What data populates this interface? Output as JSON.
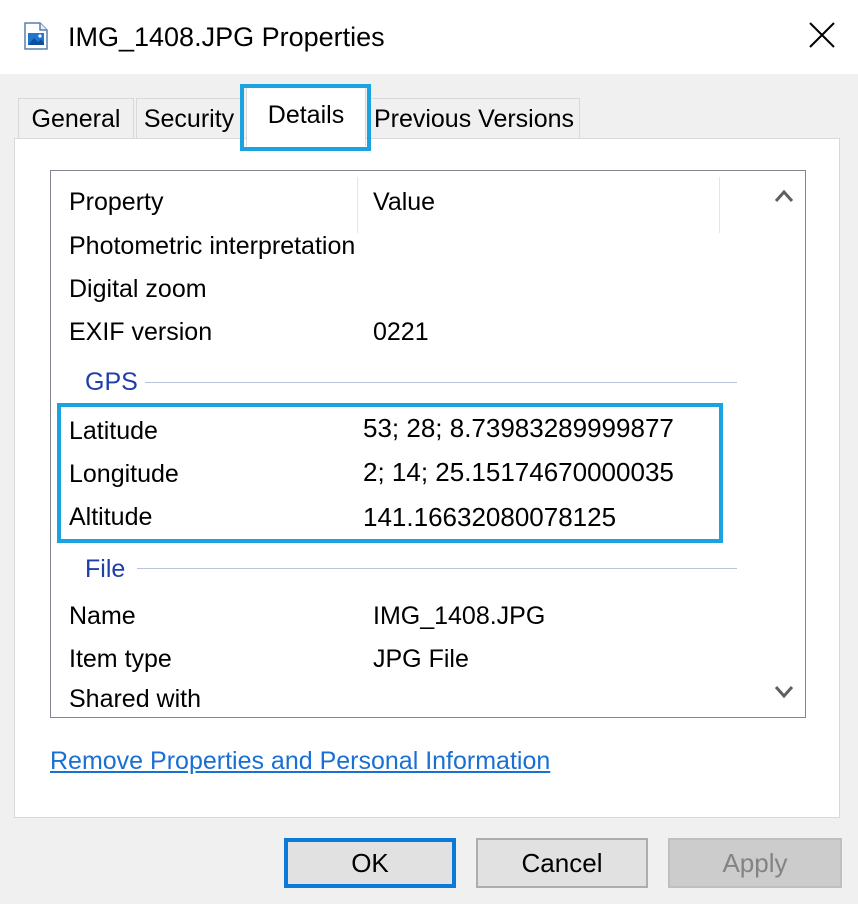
{
  "window": {
    "title": "IMG_1408.JPG Properties",
    "icon": "image-file-icon",
    "close_icon": "close-icon"
  },
  "tabs": [
    {
      "label": "General",
      "active": false
    },
    {
      "label": "Security",
      "active": false
    },
    {
      "label": "Details",
      "active": true
    },
    {
      "label": "Previous Versions",
      "active": false
    }
  ],
  "details": {
    "columns": {
      "property": "Property",
      "value": "Value"
    },
    "rows": [
      {
        "label": "Photometric interpretation",
        "value": ""
      },
      {
        "label": "Digital zoom",
        "value": ""
      },
      {
        "label": "EXIF version",
        "value": "0221"
      }
    ],
    "gps_group": {
      "title": "GPS",
      "rows": [
        {
          "label": "Latitude",
          "value": "53; 28; 8.73983289999877"
        },
        {
          "label": "Longitude",
          "value": "2; 14; 25.15174670000035"
        },
        {
          "label": "Altitude",
          "value": "141.16632080078125"
        }
      ]
    },
    "file_group": {
      "title": "File",
      "rows": [
        {
          "label": "Name",
          "value": "IMG_1408.JPG"
        },
        {
          "label": "Item type",
          "value": "JPG File"
        },
        {
          "label": "Shared with",
          "value": ""
        }
      ]
    }
  },
  "link": {
    "label": "Remove Properties and Personal Information"
  },
  "buttons": {
    "ok": "OK",
    "cancel": "Cancel",
    "apply": "Apply"
  },
  "colors": {
    "highlight": "#1aa3e0",
    "group_title": "#1e3ea8",
    "link": "#1a6fd4",
    "default_button_border": "#0a7ad8"
  }
}
